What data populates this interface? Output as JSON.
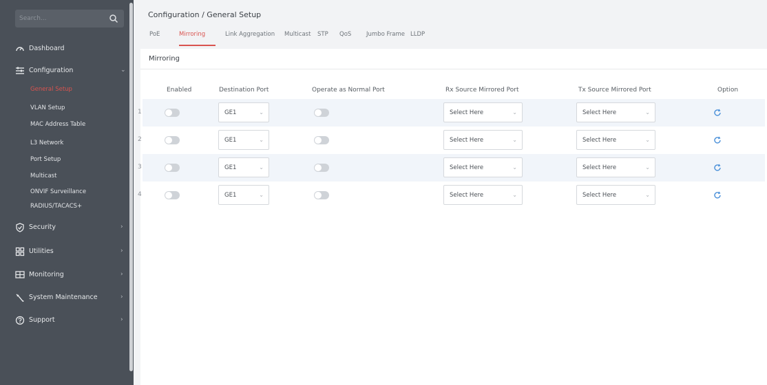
{
  "sidebar": {
    "search_placeholder": "Search...",
    "items": [
      {
        "label": "Dashboard",
        "icon": "dashboard-icon"
      },
      {
        "label": "Configuration",
        "icon": "configuration-icon"
      },
      {
        "label": "Security",
        "icon": "shield-icon"
      },
      {
        "label": "Utilities",
        "icon": "utilities-icon"
      },
      {
        "label": "Monitoring",
        "icon": "monitor-icon"
      },
      {
        "label": "System Maintenance",
        "icon": "wrench-icon"
      },
      {
        "label": "Support",
        "icon": "question-icon"
      }
    ],
    "config_sub": [
      "General Setup",
      "VLAN Setup",
      "MAC Address Table",
      "L3 Network",
      "Port Setup",
      "Multicast",
      "ONVIF Surveillance",
      "RADIUS/TACACS+"
    ],
    "active_sub": "General Setup"
  },
  "breadcrumb": "Configuration / General Setup",
  "tabs": [
    "PoE",
    "Mirroring",
    "Link Aggregation",
    "Multicast",
    "STP",
    "QoS",
    "Jumbo Frame",
    "LLDP"
  ],
  "active_tab": "Mirroring",
  "panel_title": "Mirroring",
  "table": {
    "headers": [
      "Enabled",
      "Destination Port",
      "Operate as Normal Port",
      "Rx Source Mirrored Port",
      "Tx Source Mirrored Port",
      "Option"
    ],
    "rows": [
      {
        "num": "1",
        "dest": "GE1",
        "rx": "Select Here",
        "tx": "Select Here"
      },
      {
        "num": "2",
        "dest": "GE1",
        "rx": "Select Here",
        "tx": "Select Here"
      },
      {
        "num": "3",
        "dest": "GE1",
        "rx": "Select Here",
        "tx": "Select Here"
      },
      {
        "num": "4",
        "dest": "GE1",
        "rx": "Select Here",
        "tx": "Select Here"
      }
    ]
  },
  "colors": {
    "accent": "#d9534f",
    "sidebar_bg": "#4a5058",
    "link_blue": "#4a90d9",
    "row_alt": "#f1f5fa"
  }
}
